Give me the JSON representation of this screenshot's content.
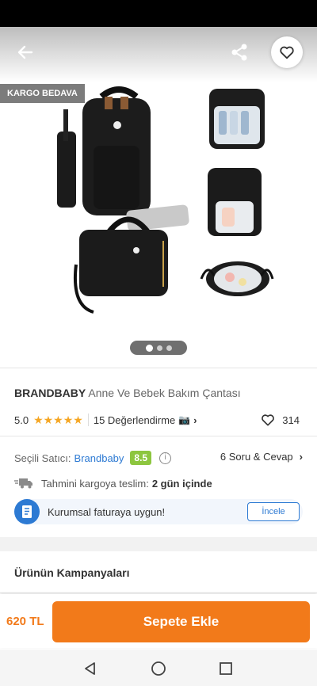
{
  "hero": {
    "badge": "KARGO BEDAVA",
    "image_count": 3,
    "active_image": 1
  },
  "product": {
    "brand": "BRANDBABY",
    "name": "Anne Ve Bebek Bakım Çantası",
    "rating": "5.0",
    "rating_stars": 5,
    "reviews": "15 Değerlendirme",
    "likes": "314"
  },
  "seller": {
    "label": "Seçili Satıcı:",
    "name": "Brandbaby",
    "score": "8.5",
    "qa": "6 Soru & Cevap"
  },
  "shipping": {
    "label": "Tahmini kargoya teslim:",
    "value": "2 gün içinde"
  },
  "corporate": {
    "text": "Kurumsal faturaya uygun!",
    "button": "İncele"
  },
  "campaigns": {
    "title": "Ürünün Kampanyaları"
  },
  "bottom": {
    "price": "620 TL",
    "add_to_cart": "Sepete Ekle"
  },
  "colors": {
    "accent": "#f27a1a",
    "link": "#2d7ad3",
    "score_badge": "#8dc63f",
    "star": "#f5a623"
  },
  "icons": [
    "back-arrow-icon",
    "share-icon",
    "heart-icon",
    "info-icon",
    "truck-icon",
    "invoice-icon",
    "camera-icon",
    "nav-back-icon",
    "nav-home-icon",
    "nav-recent-icon"
  ]
}
